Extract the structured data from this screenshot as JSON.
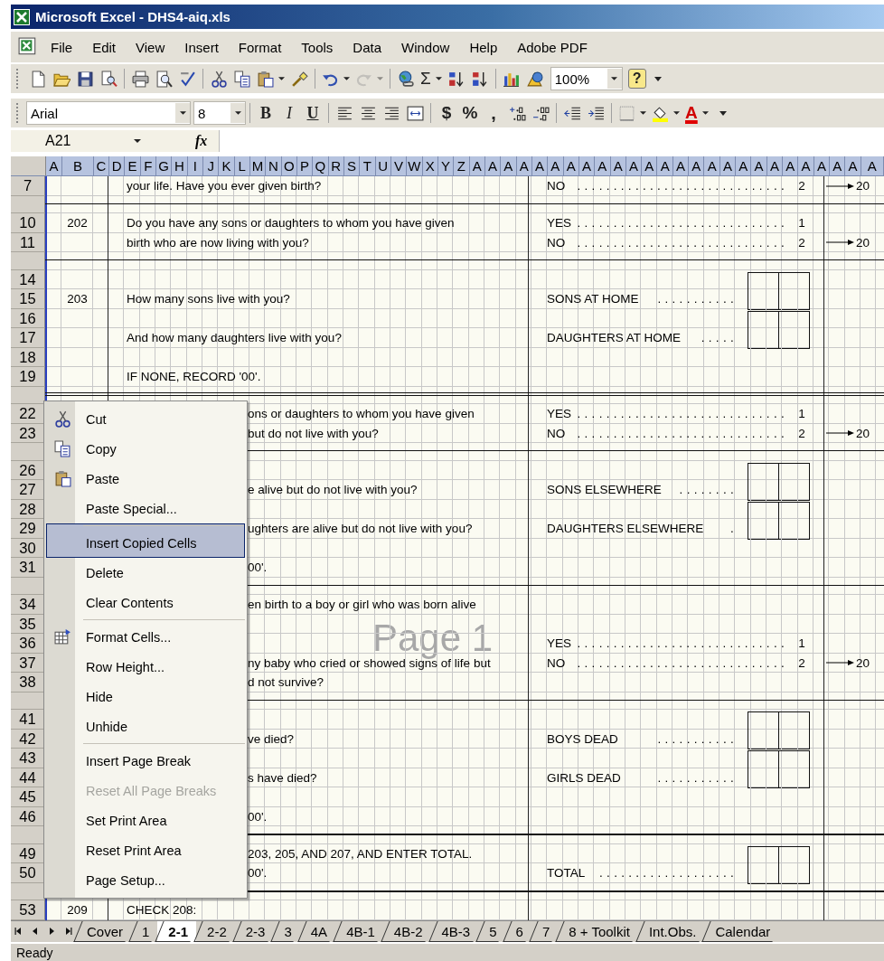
{
  "window": {
    "title": "Microsoft Excel - DHS4-aiq.xls"
  },
  "menu_bar": [
    "File",
    "Edit",
    "View",
    "Insert",
    "Format",
    "Tools",
    "Data",
    "Window",
    "Help",
    "Adobe PDF"
  ],
  "standard_toolbar": [
    {
      "kind": "new",
      "disabled": false,
      "has_menu": false
    },
    {
      "kind": "open",
      "disabled": false,
      "has_menu": false
    },
    {
      "kind": "save",
      "disabled": false,
      "has_menu": false
    },
    {
      "kind": "permission",
      "disabled": false,
      "has_menu": false
    },
    {
      "kind": "print",
      "disabled": false,
      "has_menu": false
    },
    {
      "kind": "preview",
      "disabled": false,
      "has_menu": false
    },
    {
      "kind": "spelling",
      "disabled": false,
      "has_menu": false
    },
    {
      "kind": "cut",
      "disabled": false,
      "has_menu": false
    },
    {
      "kind": "copy",
      "disabled": false,
      "has_menu": false
    },
    {
      "kind": "paste",
      "disabled": false,
      "has_menu": true
    },
    {
      "kind": "painter",
      "disabled": false,
      "has_menu": false
    },
    {
      "kind": "undo",
      "disabled": false,
      "has_menu": true
    },
    {
      "kind": "redo",
      "disabled": true,
      "has_menu": true
    },
    {
      "kind": "hyperlink",
      "disabled": false,
      "has_menu": false
    },
    {
      "kind": "sum",
      "label": "Σ",
      "disabled": false,
      "has_menu": true
    },
    {
      "kind": "sort-asc",
      "disabled": false,
      "has_menu": false
    },
    {
      "kind": "sort-desc",
      "disabled": false,
      "has_menu": false
    },
    {
      "kind": "chart",
      "disabled": false,
      "has_menu": false
    },
    {
      "kind": "drawing",
      "disabled": false,
      "has_menu": false
    },
    {
      "kind": "zoom",
      "value": "100%",
      "disabled": false,
      "has_menu": true
    },
    {
      "kind": "help",
      "label": "?",
      "disabled": false,
      "has_menu": false
    },
    {
      "kind": "options",
      "disabled": false,
      "has_menu": false
    }
  ],
  "formatting_toolbar": [
    {
      "kind": "font",
      "value": "Arial",
      "has_menu": true
    },
    {
      "kind": "size",
      "value": "8",
      "has_menu": true
    },
    {
      "kind": "bold",
      "label": "B",
      "has_menu": false
    },
    {
      "kind": "italic",
      "label": "I",
      "has_menu": false
    },
    {
      "kind": "underline",
      "label": "U",
      "has_menu": false
    },
    {
      "kind": "align-left",
      "has_menu": false
    },
    {
      "kind": "align-center",
      "has_menu": false
    },
    {
      "kind": "align-right",
      "has_menu": false
    },
    {
      "kind": "merge",
      "has_menu": false
    },
    {
      "kind": "currency",
      "label": "$",
      "has_menu": false
    },
    {
      "kind": "percent",
      "label": "%",
      "has_menu": false
    },
    {
      "kind": "comma",
      "label": ",",
      "has_menu": false
    },
    {
      "kind": "inc-decimal",
      "has_menu": false
    },
    {
      "kind": "dec-decimal",
      "has_menu": false
    },
    {
      "kind": "outdent",
      "has_menu": false
    },
    {
      "kind": "indent",
      "has_menu": false
    },
    {
      "kind": "borders",
      "has_menu": true
    },
    {
      "kind": "fill",
      "has_menu": true
    },
    {
      "kind": "font-color",
      "label": "A",
      "has_menu": true
    },
    {
      "kind": "options",
      "has_menu": false
    }
  ],
  "formula_bar": {
    "name_box": "A21",
    "fx": "fx"
  },
  "columns": [
    "A",
    "B",
    "C",
    "D",
    "E",
    "F",
    "G",
    "H",
    "I",
    "J",
    "K",
    "L",
    "M",
    "N",
    "O",
    "P",
    "Q",
    "R",
    "S",
    "T",
    "U",
    "V",
    "W",
    "X",
    "Y",
    "Z",
    "A",
    "A",
    "A",
    "A",
    "A",
    "A",
    "A",
    "A",
    "A",
    "A",
    "A",
    "A",
    "A",
    "A",
    "A",
    "A",
    "A",
    "A",
    "A",
    "A",
    "A",
    "A",
    "A",
    "A",
    "A",
    "A"
  ],
  "rows": [
    {
      "kind": "row",
      "number": "7",
      "question": {
        "text": "your life. Have you ever given birth?",
        "partial": false
      },
      "answer": {
        "kind": "coded",
        "label": "NO",
        "dots": ".............................",
        "value": "2"
      },
      "skip": "20"
    },
    {
      "kind": "break"
    },
    {
      "kind": "row",
      "number": "10",
      "code": "202",
      "question": {
        "text": "Do you have any sons or daughters to whom you have given",
        "partial": false
      },
      "answer": {
        "kind": "coded",
        "label": "YES",
        "dots": ".............................",
        "value": "1"
      }
    },
    {
      "kind": "row",
      "number": "11",
      "question": {
        "text": "birth who are now living with you?",
        "partial": false
      },
      "answer": {
        "kind": "coded",
        "label": "NO",
        "dots": ".............................",
        "value": "2"
      },
      "skip": "20"
    },
    {
      "kind": "break"
    },
    {
      "kind": "row",
      "number": "14"
    },
    {
      "kind": "row",
      "number": "15",
      "code": "203",
      "question": {
        "text": "How many sons live with you?",
        "partial": false
      },
      "answer": {
        "kind": "count",
        "label": "SONS AT HOME",
        "dots": "..........."
      }
    },
    {
      "kind": "row",
      "number": "16"
    },
    {
      "kind": "row",
      "number": "17",
      "question": {
        "text": "And how many daughters live with you?",
        "partial": false
      },
      "answer": {
        "kind": "count",
        "label": "DAUGHTERS AT HOME",
        "dots": "....."
      }
    },
    {
      "kind": "row",
      "number": "18"
    },
    {
      "kind": "row",
      "number": "19",
      "question": {
        "text": "IF NONE, RECORD '00'.",
        "partial": false
      }
    },
    {
      "kind": "double"
    },
    {
      "kind": "row",
      "number": "22",
      "question": {
        "text": "ons or daughters to whom you have given",
        "partial": true
      },
      "answer": {
        "kind": "coded",
        "label": "YES",
        "dots": ".............................",
        "value": "1"
      }
    },
    {
      "kind": "row",
      "number": "23",
      "question": {
        "text": "but do not live with you?",
        "partial": true
      },
      "answer": {
        "kind": "coded",
        "label": "NO",
        "dots": ".............................",
        "value": "2"
      },
      "skip": "20"
    },
    {
      "kind": "break"
    },
    {
      "kind": "row",
      "number": "26"
    },
    {
      "kind": "row",
      "number": "27",
      "question": {
        "text": "e alive but do not live with you?",
        "partial": true
      },
      "answer": {
        "kind": "count",
        "label": "SONS ELSEWHERE",
        "dots": "........"
      }
    },
    {
      "kind": "row",
      "number": "28"
    },
    {
      "kind": "row",
      "number": "29",
      "question": {
        "text": "ughters are alive but do not live with you?",
        "partial": true
      },
      "answer": {
        "kind": "count",
        "label": "DAUGHTERS ELSEWHERE",
        "dots": "."
      }
    },
    {
      "kind": "row",
      "number": "30"
    },
    {
      "kind": "row",
      "number": "31",
      "question": {
        "text": "00'.",
        "partial": true
      }
    },
    {
      "kind": "break"
    },
    {
      "kind": "row",
      "number": "34",
      "question": {
        "text": "en birth to a boy or girl who was born alive",
        "partial": true
      }
    },
    {
      "kind": "row",
      "number": "35"
    },
    {
      "kind": "row",
      "number": "36",
      "answer": {
        "kind": "coded",
        "label": "YES",
        "dots": ".............................",
        "value": "1"
      }
    },
    {
      "kind": "row",
      "number": "37",
      "question": {
        "text": "ny baby who cried or showed signs of life but",
        "partial": true
      },
      "answer": {
        "kind": "coded",
        "label": "NO",
        "dots": ".............................",
        "value": "2"
      },
      "skip": "20"
    },
    {
      "kind": "row",
      "number": "38",
      "question": {
        "text": "d not survive?",
        "partial": true
      }
    },
    {
      "kind": "break"
    },
    {
      "kind": "row",
      "number": "41"
    },
    {
      "kind": "row",
      "number": "42",
      "question": {
        "text": "ve died?",
        "partial": true
      },
      "answer": {
        "kind": "count",
        "label": "BOYS DEAD",
        "dots": "..........."
      }
    },
    {
      "kind": "row",
      "number": "43"
    },
    {
      "kind": "row",
      "number": "44",
      "question": {
        "text": "s have died?",
        "partial": true
      },
      "answer": {
        "kind": "count",
        "label": "GIRLS DEAD",
        "dots": "..........."
      }
    },
    {
      "kind": "row",
      "number": "45"
    },
    {
      "kind": "row",
      "number": "46",
      "question": {
        "text": "00'.",
        "partial": true
      }
    },
    {
      "kind": "heavy"
    },
    {
      "kind": "row",
      "number": "49",
      "question": {
        "text": "203, 205, AND 207, AND ENTER TOTAL.",
        "partial": true
      }
    },
    {
      "kind": "row",
      "number": "50",
      "question": {
        "text": "00'.",
        "partial": true
      },
      "answer": {
        "kind": "count",
        "label": "TOTAL",
        "dots": "..................."
      }
    },
    {
      "kind": "heavy"
    },
    {
      "kind": "row",
      "number": "53",
      "code": "209",
      "question": {
        "text": "CHECK 208:",
        "partial": false
      }
    }
  ],
  "page_label": "Page 1",
  "context_menu": [
    {
      "label": "Cut",
      "selected": false,
      "disabled": false,
      "separator_before": false
    },
    {
      "label": "Copy",
      "selected": false,
      "disabled": false,
      "separator_before": false
    },
    {
      "label": "Paste",
      "selected": false,
      "disabled": false,
      "separator_before": false
    },
    {
      "label": "Paste Special...",
      "selected": false,
      "disabled": false,
      "separator_before": false
    },
    {
      "label": "Insert Copied Cells",
      "selected": true,
      "disabled": false,
      "separator_before": true
    },
    {
      "label": "Delete",
      "selected": false,
      "disabled": false,
      "separator_before": false
    },
    {
      "label": "Clear Contents",
      "selected": false,
      "disabled": false,
      "separator_before": false
    },
    {
      "label": "Format Cells...",
      "selected": false,
      "disabled": false,
      "separator_before": true
    },
    {
      "label": "Row Height...",
      "selected": false,
      "disabled": false,
      "separator_before": false
    },
    {
      "label": "Hide",
      "selected": false,
      "disabled": false,
      "separator_before": false
    },
    {
      "label": "Unhide",
      "selected": false,
      "disabled": false,
      "separator_before": false
    },
    {
      "label": "Insert Page Break",
      "selected": false,
      "disabled": false,
      "separator_before": true
    },
    {
      "label": "Reset All Page Breaks",
      "selected": false,
      "disabled": true,
      "separator_before": false
    },
    {
      "label": "Set Print Area",
      "selected": false,
      "disabled": false,
      "separator_before": false
    },
    {
      "label": "Reset Print Area",
      "selected": false,
      "disabled": false,
      "separator_before": false
    },
    {
      "label": "Page Setup...",
      "selected": false,
      "disabled": false,
      "separator_before": false
    }
  ],
  "sheet_tabs": [
    {
      "label": "Cover",
      "selected": false
    },
    {
      "label": "1",
      "selected": false
    },
    {
      "label": "2-1",
      "selected": true
    },
    {
      "label": "2-2",
      "selected": false
    },
    {
      "label": "2-3",
      "selected": false
    },
    {
      "label": "3",
      "selected": false
    },
    {
      "label": "4A",
      "selected": false
    },
    {
      "label": "4B-1",
      "selected": false
    },
    {
      "label": "4B-2",
      "selected": false
    },
    {
      "label": "4B-3",
      "selected": false
    },
    {
      "label": "5",
      "selected": false
    },
    {
      "label": "6",
      "selected": false
    },
    {
      "label": "7",
      "selected": false
    },
    {
      "label": "8 + Toolkit",
      "selected": false
    },
    {
      "label": "Int.Obs.",
      "selected": false
    },
    {
      "label": "Calendar",
      "selected": false
    }
  ],
  "status_bar": "Ready"
}
